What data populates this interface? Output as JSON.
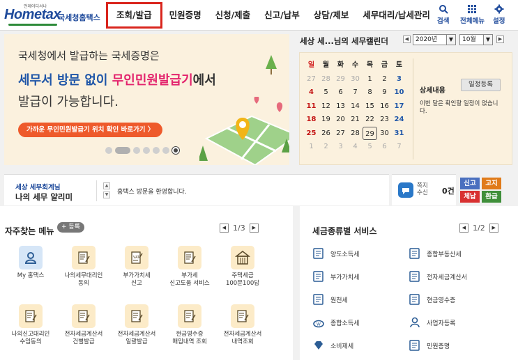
{
  "header": {
    "logo_tagline": "언제어디서나",
    "logo_text": "Hometax",
    "logo_sub": "국세청홈택스",
    "nav": [
      "조회/발급",
      "민원증명",
      "신청/제출",
      "신고/납부",
      "상담/제보",
      "세무대리/납세관리"
    ],
    "active_nav": "조회/발급",
    "utils": [
      {
        "label": "검색",
        "icon": "search-icon"
      },
      {
        "label": "전체메뉴",
        "icon": "grid-menu-icon"
      },
      {
        "label": "설정",
        "icon": "gear-icon"
      }
    ]
  },
  "banner": {
    "line1": "국세청에서 발급하는 국세증명은",
    "line2_a": "세무서 방문 없이 ",
    "line2_b": "무인민원발급기",
    "line2_c": "에서",
    "line3": "발급이 가능합니다.",
    "button": "가까운 무인민원발급기 위치 확인 바로가기 〉",
    "slide_count": 6,
    "active_slide": 2
  },
  "calendar": {
    "title": "세상 세...님의 세무캘린더",
    "year": "2020년",
    "month": "10월",
    "weekdays": [
      "일",
      "월",
      "화",
      "수",
      "목",
      "금",
      "토"
    ],
    "weeks": [
      [
        "27",
        "28",
        "29",
        "30",
        "1",
        "2",
        "3"
      ],
      [
        "4",
        "5",
        "6",
        "7",
        "8",
        "9",
        "10"
      ],
      [
        "11",
        "12",
        "13",
        "14",
        "15",
        "16",
        "17"
      ],
      [
        "18",
        "19",
        "20",
        "21",
        "22",
        "23",
        "24"
      ],
      [
        "25",
        "26",
        "27",
        "28",
        "29",
        "30",
        "31"
      ],
      [
        "1",
        "2",
        "3",
        "4",
        "5",
        "6",
        "7"
      ]
    ],
    "today": "29",
    "detail_title": "상세내용",
    "register_button": "일정등록",
    "detail_text": "이번 달은 확인할 일정이 없습니다."
  },
  "notice": {
    "label_top": "세상 세무회계님",
    "label_main": "나의 세무 알리미",
    "message": "홈택스 방문을 환영합니다."
  },
  "messages": {
    "label": "쪽지\n수신",
    "count": "0건",
    "tags": [
      {
        "label": "신고",
        "color": "#4a6fbf"
      },
      {
        "label": "고지",
        "color": "#e07b1a"
      },
      {
        "label": "체납",
        "color": "#d83030"
      },
      {
        "label": "환급",
        "color": "#3f8f3a"
      }
    ]
  },
  "favorites": {
    "title": "자주찾는 메뉴",
    "add_label": "등록",
    "page": "1",
    "total": "/3",
    "items": [
      {
        "label": "My 홈택스",
        "icon": "person-icon"
      },
      {
        "label": "나의세무대리인\n동의",
        "icon": "document-pen-icon"
      },
      {
        "label": "부가가치세\n신고",
        "icon": "vat-document-icon"
      },
      {
        "label": "부가세\n신고도움 서비스",
        "icon": "magnifier-document-icon"
      },
      {
        "label": "주택세금\n100문100답",
        "icon": "house-icon"
      },
      {
        "label": "나의신고대리인\n수임동의",
        "icon": "document-pen-icon"
      },
      {
        "label": "전자세금계산서\n건별발급",
        "icon": "invoice-icon"
      },
      {
        "label": "전자세금계산서\n일괄발급",
        "icon": "invoice-stack-icon"
      },
      {
        "label": "현금영수증\n매입내역 조회",
        "icon": "receipt-search-icon"
      },
      {
        "label": "전자세금계산서\n내역조회",
        "icon": "invoice-search-icon"
      }
    ]
  },
  "taxes": {
    "title": "세금종류별 서비스",
    "page": "1",
    "total": "/2",
    "items": [
      {
        "label": "양도소득세",
        "icon": "transfer-icon"
      },
      {
        "label": "종합부동산세",
        "icon": "building-icon"
      },
      {
        "label": "부가가치세",
        "icon": "vat-icon"
      },
      {
        "label": "전자세금계산서",
        "icon": "e-invoice-icon"
      },
      {
        "label": "원천세",
        "icon": "withholding-icon"
      },
      {
        "label": "현금영수증",
        "icon": "cash-receipt-icon"
      },
      {
        "label": "종합소득세",
        "icon": "income-icon"
      },
      {
        "label": "사업자등록",
        "icon": "business-person-icon"
      },
      {
        "label": "소비제세",
        "icon": "diamond-icon"
      },
      {
        "label": "민원증명",
        "icon": "certificate-icon"
      }
    ]
  }
}
